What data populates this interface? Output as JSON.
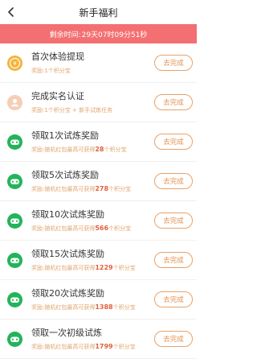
{
  "header": {
    "title": "新手福利"
  },
  "banner": {
    "label": "剩余时间:",
    "time": "29天07时09分51秒"
  },
  "tasks": [
    {
      "icon": "coin-icon",
      "title": "首次体验提现",
      "reward_prefix": "奖励:1个积分宝",
      "reward_num": "",
      "reward_suffix": "",
      "button": "去完成"
    },
    {
      "icon": "person-icon",
      "title": "完成实名认证",
      "reward_prefix": "奖励:1个积分宝 + 新手试炼任务",
      "reward_num": "",
      "reward_suffix": "",
      "button": "去完成"
    },
    {
      "icon": "gamepad-icon",
      "title": "领取1次试炼奖励",
      "reward_prefix": "奖励:随机红包最高可获得",
      "reward_num": "28",
      "reward_suffix": "个积分宝",
      "button": "去完成"
    },
    {
      "icon": "gamepad-icon",
      "title": "领取5次试炼奖励",
      "reward_prefix": "奖励:随机红包最高可获得",
      "reward_num": "278",
      "reward_suffix": "个积分宝",
      "button": "去完成"
    },
    {
      "icon": "gamepad-icon",
      "title": "领取10次试炼奖励",
      "reward_prefix": "奖励:随机红包最高可获得",
      "reward_num": "566",
      "reward_suffix": "个积分宝",
      "button": "去完成"
    },
    {
      "icon": "gamepad-icon",
      "title": "领取15次试炼奖励",
      "reward_prefix": "奖励:随机红包最高可获得",
      "reward_num": "1229",
      "reward_suffix": "个积分宝",
      "button": "去完成"
    },
    {
      "icon": "gamepad-icon",
      "title": "领取20次试炼奖励",
      "reward_prefix": "奖励:随机红包最高可获得",
      "reward_num": "1388",
      "reward_suffix": "个积分宝",
      "button": "去完成"
    },
    {
      "icon": "gamepad-icon",
      "title": "领取一次初级试炼",
      "reward_prefix": "奖励:随机红包最高可获得",
      "reward_num": "1799",
      "reward_suffix": "个积分宝",
      "button": "去完成"
    }
  ],
  "colors": {
    "banner": "#f46f71",
    "accent": "#e09254",
    "game_icon": "#23b45a",
    "coin_icon": "#f4b33a"
  }
}
